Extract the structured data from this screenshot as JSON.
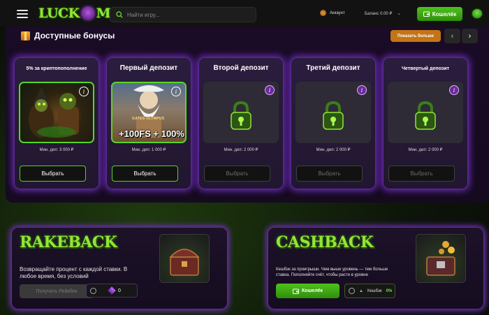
{
  "header": {
    "logo_left": "LUCK",
    "logo_right": "MORE",
    "search_placeholder": "Найти игру...",
    "account_label": "Аккаунт",
    "balance_label": "Баланс 0.00 ₽",
    "wallet_label": "Кошелёк"
  },
  "bonuses": {
    "title": "Доступные бонусы",
    "show_more_label": "Показать больше",
    "prev_icon": "chevron-left-icon",
    "next_icon": "chevron-right-icon",
    "cards": [
      {
        "title": "5% за криптопополнение",
        "min_deposit": "Мин. деп: 3 000 ₽",
        "button": "Выбрать",
        "state": "active"
      },
      {
        "title": "Первый депозит",
        "min_deposit": "Мин. деп: 1 000 ₽",
        "button": "Выбрать",
        "state": "active",
        "overlay_text": "+100FS + 100%",
        "game_text": "GATES OLYMPUS"
      },
      {
        "title": "Второй депозит",
        "min_deposit": "Мин. деп: 2 000 ₽",
        "button": "Выбрать",
        "state": "locked"
      },
      {
        "title": "Третий депозит",
        "min_deposit": "Мин. деп: 2 000 ₽",
        "button": "Выбрать",
        "state": "locked"
      },
      {
        "title": "Четвертый депозит",
        "min_deposit": "Мин. деп: 2 000 ₽",
        "button": "Выбрать",
        "state": "locked"
      }
    ]
  },
  "rakeback": {
    "title": "RAKEBACK",
    "description_line1": "Возвращайте процент с каждой ставки. В",
    "description_line2": "любое время, без условий",
    "button_label": "Получить Рейкбек",
    "counter_value": "0"
  },
  "cashback": {
    "title": "CASHBACK",
    "description_line1": "Кешбэк за проигрыши. Чем выше уровень — тем больше",
    "description_line2": "ставка. Пополняйте счёт, чтобы расти в уровне",
    "button_label": "Кошелёк",
    "counter_label": "Кешбэк",
    "counter_value": "0%"
  },
  "colors": {
    "accent_green": "#4fc21b",
    "accent_orange": "#c37417",
    "card_glow": "#6f2ebf"
  }
}
